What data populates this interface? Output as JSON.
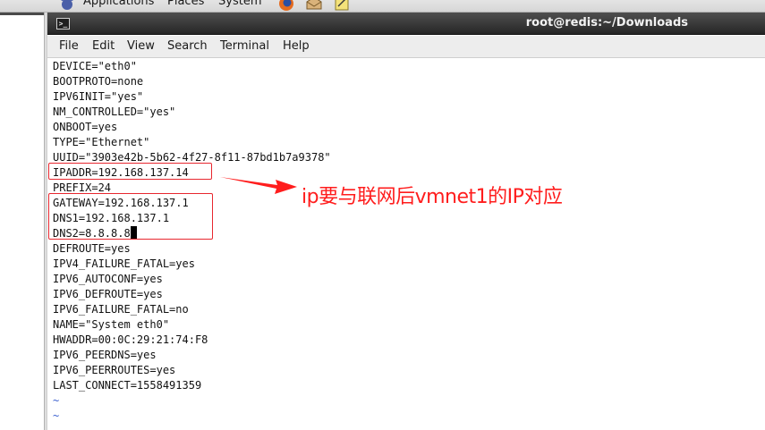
{
  "top_panel": {
    "menus": [
      "Applications",
      "Places",
      "System"
    ],
    "icons": [
      "gnome-foot-icon",
      "firefox-icon",
      "mail-icon",
      "notes-icon"
    ]
  },
  "window": {
    "title": "root@redis:~/Downloads",
    "title_icon": "terminal-icon"
  },
  "menubar": [
    "File",
    "Edit",
    "View",
    "Search",
    "Terminal",
    "Help"
  ],
  "terminal": {
    "lines": [
      "DEVICE=\"eth0\"",
      "BOOTPROTO=none",
      "IPV6INIT=\"yes\"",
      "NM_CONTROLLED=\"yes\"",
      "ONBOOT=yes",
      "TYPE=\"Ethernet\"",
      "UUID=\"3903e42b-5b62-4f27-8f11-87bd1b7a9378\"",
      "IPADDR=192.168.137.14",
      "PREFIX=24",
      "GATEWAY=192.168.137.1",
      "DNS1=192.168.137.1",
      "DNS2=8.8.8.8",
      "DEFROUTE=yes",
      "IPV4_FAILURE_FATAL=yes",
      "IPV6_AUTOCONF=yes",
      "IPV6_DEFROUTE=yes",
      "IPV6_FAILURE_FATAL=no",
      "NAME=\"System eth0\"",
      "HWADDR=00:0C:29:21:74:F8",
      "IPV6_PEERDNS=yes",
      "IPV6_PEERROUTES=yes",
      "LAST_CONNECT=1558491359",
      "~",
      "~"
    ]
  },
  "annotation": {
    "text": "ip要与联网后vmnet1的IP对应",
    "color": "#ff1d1d"
  },
  "colors": {
    "titlebar": "#2e2e2e",
    "highlight": "#e8272f",
    "vim_tilde": "#3a5fcf"
  }
}
